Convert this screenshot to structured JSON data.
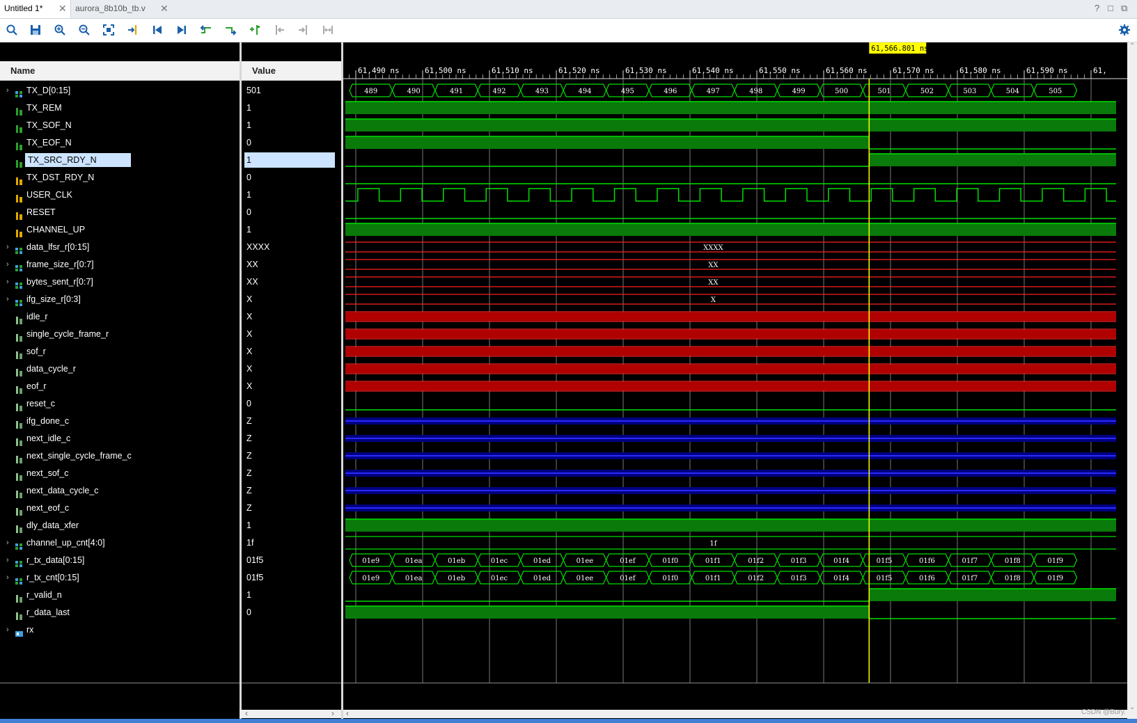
{
  "tabs": [
    {
      "label": "Untitled 1*",
      "active": true
    },
    {
      "label": "aurora_8b10b_tb.v",
      "active": false
    }
  ],
  "window_controls": [
    "?",
    "□",
    "⧉"
  ],
  "toolbar_icons": [
    "search-icon",
    "save-icon",
    "zoom-in-icon",
    "zoom-out-icon",
    "zoom-fit-icon",
    "go-to-cursor-icon",
    "go-to-start-icon",
    "go-to-end-icon",
    "previous-transition-icon",
    "next-transition-icon",
    "add-marker-icon",
    "previous-marker-icon",
    "next-marker-icon",
    "swap-cursors-icon",
    "settings-icon"
  ],
  "columns": {
    "name": "Name",
    "value": "Value"
  },
  "cursor": {
    "label": "61,566.801 ns",
    "time": 61566.801
  },
  "time_axis": {
    "start": 61488.4,
    "end": 61600,
    "tick_step": 10,
    "minor_step": 1,
    "labels": [
      "61,490 ns",
      "61,500 ns",
      "61,510 ns",
      "61,520 ns",
      "61,530 ns",
      "61,540 ns",
      "61,550 ns",
      "61,560 ns",
      "61,570 ns",
      "61,580 ns",
      "61,590 ns",
      "61,"
    ]
  },
  "signals": [
    {
      "name": "TX_D[0:15]",
      "value": "501",
      "kind": "bus",
      "expand": true,
      "icon": "bus",
      "wave": "bus",
      "busvals": [
        "489",
        "490",
        "491",
        "492",
        "493",
        "494",
        "495",
        "496",
        "497",
        "498",
        "499",
        "500",
        "501",
        "502",
        "503",
        "504",
        "505"
      ]
    },
    {
      "name": "TX_REM",
      "value": "1",
      "kind": "bit",
      "icon": "bit-green",
      "wave": "high"
    },
    {
      "name": "TX_SOF_N",
      "value": "1",
      "kind": "bit",
      "icon": "bit-green",
      "wave": "high"
    },
    {
      "name": "TX_EOF_N",
      "value": "0",
      "kind": "bit",
      "icon": "bit-green",
      "wave": "high_then_low"
    },
    {
      "name": "TX_SRC_RDY_N",
      "value": "1",
      "kind": "bit",
      "icon": "bit-green",
      "wave": "low_then_high",
      "selected": true
    },
    {
      "name": "TX_DST_RDY_N",
      "value": "0",
      "kind": "bit",
      "icon": "bit-orange",
      "wave": "low"
    },
    {
      "name": "USER_CLK",
      "value": "1",
      "kind": "bit",
      "icon": "bit-orange",
      "wave": "clock"
    },
    {
      "name": "RESET",
      "value": "0",
      "kind": "bit",
      "icon": "bit-orange",
      "wave": "low"
    },
    {
      "name": "CHANNEL_UP",
      "value": "1",
      "kind": "bit",
      "icon": "bit-orange",
      "wave": "high"
    },
    {
      "name": "data_lfsr_r[0:15]",
      "value": "XXXX",
      "kind": "bus",
      "expand": true,
      "icon": "bus",
      "wave": "xbus",
      "label": "XXXX"
    },
    {
      "name": "frame_size_r[0:7]",
      "value": "XX",
      "kind": "bus",
      "expand": true,
      "icon": "bus",
      "wave": "xbus",
      "label": "XX"
    },
    {
      "name": "bytes_sent_r[0:7]",
      "value": "XX",
      "kind": "bus",
      "expand": true,
      "icon": "bus",
      "wave": "xbus",
      "label": "XX"
    },
    {
      "name": "ifg_size_r[0:3]",
      "value": "X",
      "kind": "bus",
      "expand": true,
      "icon": "bus",
      "wave": "xbus",
      "label": "X"
    },
    {
      "name": "idle_r",
      "value": "X",
      "kind": "bit",
      "icon": "bit-gray",
      "wave": "x"
    },
    {
      "name": "single_cycle_frame_r",
      "value": "X",
      "kind": "bit",
      "icon": "bit-gray",
      "wave": "x"
    },
    {
      "name": "sof_r",
      "value": "X",
      "kind": "bit",
      "icon": "bit-gray",
      "wave": "x"
    },
    {
      "name": "data_cycle_r",
      "value": "X",
      "kind": "bit",
      "icon": "bit-gray",
      "wave": "x"
    },
    {
      "name": "eof_r",
      "value": "X",
      "kind": "bit",
      "icon": "bit-gray",
      "wave": "x"
    },
    {
      "name": "reset_c",
      "value": "0",
      "kind": "bit",
      "icon": "bit-gray",
      "wave": "low"
    },
    {
      "name": "ifg_done_c",
      "value": "Z",
      "kind": "bit",
      "icon": "bit-gray",
      "wave": "z"
    },
    {
      "name": "next_idle_c",
      "value": "Z",
      "kind": "bit",
      "icon": "bit-gray",
      "wave": "z"
    },
    {
      "name": "next_single_cycle_frame_c",
      "value": "Z",
      "kind": "bit",
      "icon": "bit-gray",
      "wave": "z"
    },
    {
      "name": "next_sof_c",
      "value": "Z",
      "kind": "bit",
      "icon": "bit-gray",
      "wave": "z"
    },
    {
      "name": "next_data_cycle_c",
      "value": "Z",
      "kind": "bit",
      "icon": "bit-gray",
      "wave": "z"
    },
    {
      "name": "next_eof_c",
      "value": "Z",
      "kind": "bit",
      "icon": "bit-gray",
      "wave": "z"
    },
    {
      "name": "dly_data_xfer",
      "value": "1",
      "kind": "bit",
      "icon": "bit-gray",
      "wave": "high"
    },
    {
      "name": "channel_up_cnt[4:0]",
      "value": "1f",
      "kind": "bus",
      "expand": true,
      "icon": "bus",
      "wave": "constbus",
      "label": "1f"
    },
    {
      "name": "r_tx_data[0:15]",
      "value": "01f5",
      "kind": "bus",
      "expand": true,
      "icon": "bus",
      "wave": "bus",
      "busvals": [
        "01e9",
        "01ea",
        "01eb",
        "01ec",
        "01ed",
        "01ee",
        "01ef",
        "01f0",
        "01f1",
        "01f2",
        "01f3",
        "01f4",
        "01f5",
        "01f6",
        "01f7",
        "01f8",
        "01f9"
      ]
    },
    {
      "name": "r_tx_cnt[0:15]",
      "value": "01f5",
      "kind": "bus",
      "expand": true,
      "icon": "bus",
      "wave": "bus",
      "busvals": [
        "01e9",
        "01ea",
        "01eb",
        "01ec",
        "01ed",
        "01ee",
        "01ef",
        "01f0",
        "01f1",
        "01f2",
        "01f3",
        "01f4",
        "01f5",
        "01f6",
        "01f7",
        "01f8",
        "01f9"
      ]
    },
    {
      "name": "r_valid_n",
      "value": "1",
      "kind": "bit",
      "icon": "bit-gray",
      "wave": "low_then_high"
    },
    {
      "name": "r_data_last",
      "value": "0",
      "kind": "bit",
      "icon": "bit-gray",
      "wave": "high_then_low"
    },
    {
      "name": "rx",
      "value": "",
      "kind": "group",
      "expand": true,
      "icon": "group",
      "wave": "none"
    }
  ],
  "clock": {
    "period_ns": 6.4,
    "first_rise_ns": 61490.3
  },
  "watermark": "CSDN @Bury."
}
